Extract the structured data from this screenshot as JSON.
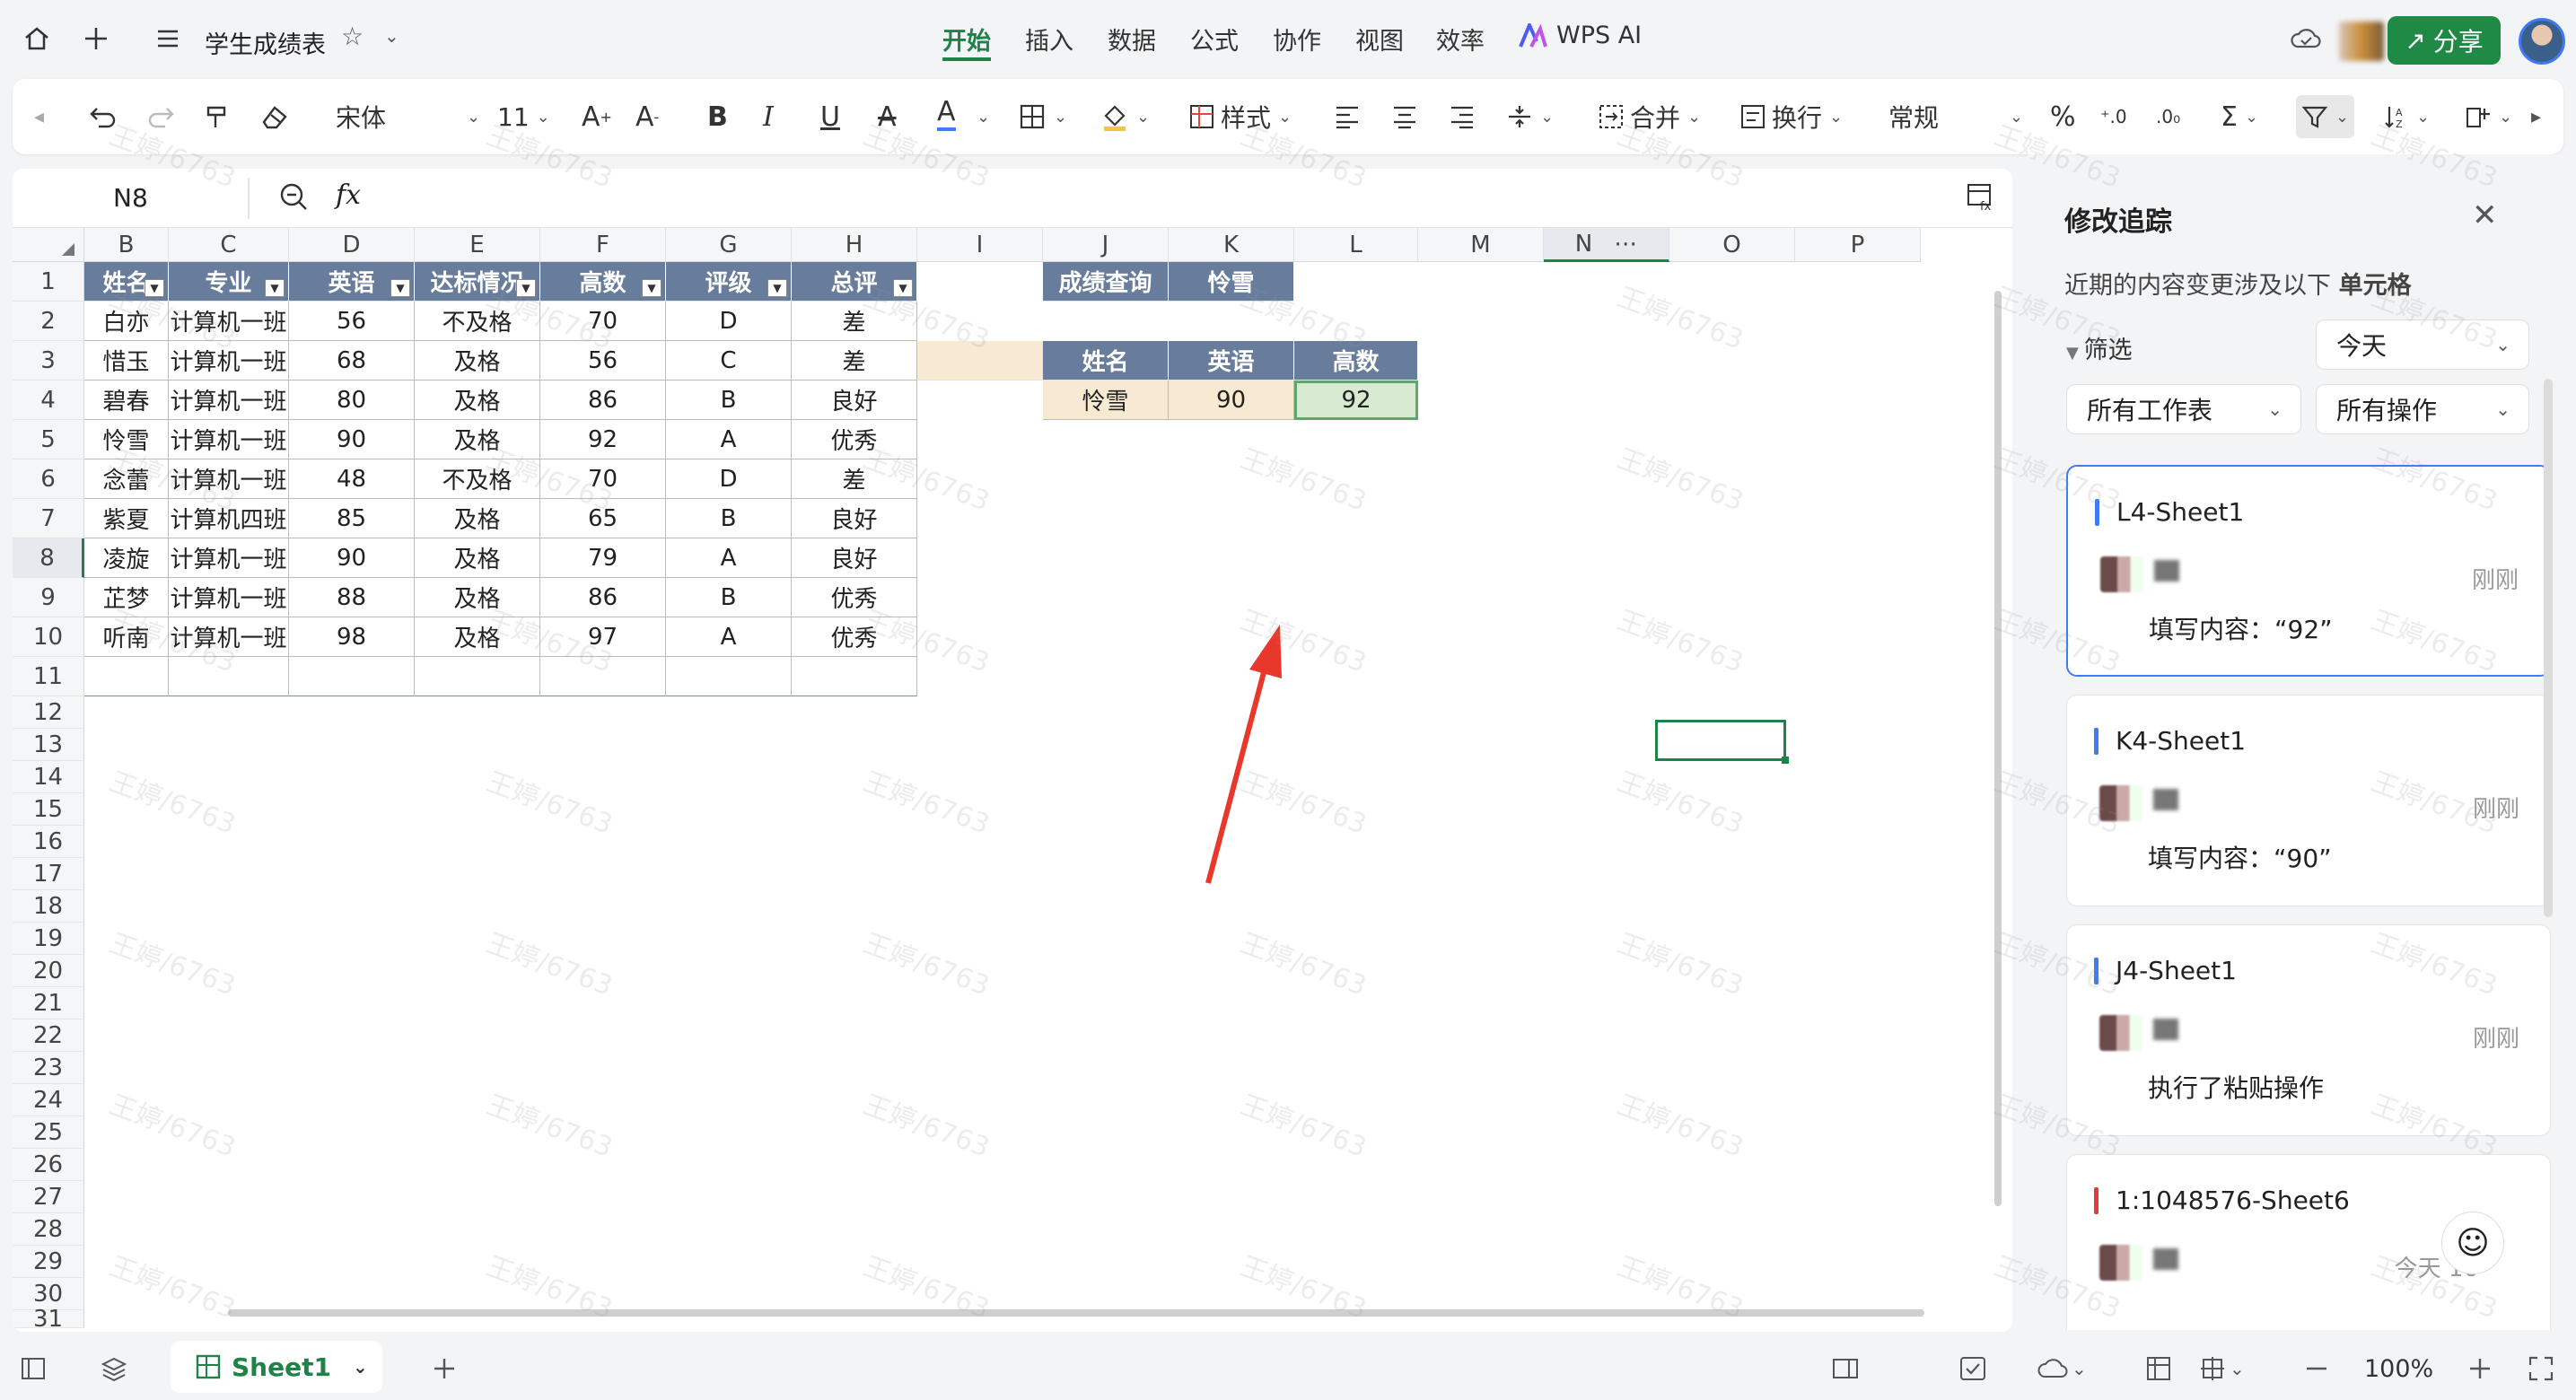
{
  "app": {
    "title": "学生成绩表",
    "menu": [
      "开始",
      "插入",
      "数据",
      "公式",
      "协作",
      "视图",
      "效率",
      "WPS AI"
    ],
    "active_menu": "开始",
    "share_label": "分享"
  },
  "toolbar": {
    "font": "宋体",
    "font_size": "11",
    "style_label": "样式",
    "merge_label": "合并",
    "wrap_label": "换行",
    "number_format": "常规"
  },
  "formula_bar": {
    "cell_ref": "N8",
    "fx": "fx",
    "value": ""
  },
  "columns": [
    "B",
    "C",
    "D",
    "E",
    "F",
    "G",
    "H",
    "I",
    "J",
    "K",
    "L",
    "M",
    "N",
    "O",
    "P"
  ],
  "rows": [
    "1",
    "2",
    "3",
    "4",
    "5",
    "6",
    "7",
    "8",
    "9",
    "10",
    "11",
    "12",
    "13",
    "14",
    "15",
    "16",
    "17",
    "18",
    "19",
    "20",
    "21",
    "22",
    "23",
    "24",
    "25",
    "26",
    "27",
    "28",
    "29",
    "30",
    "31"
  ],
  "table": {
    "headers": [
      "姓名",
      "专业",
      "英语",
      "达标情况",
      "高数",
      "评级",
      "总评"
    ],
    "rows": [
      [
        "白亦",
        "计算机一班",
        "56",
        "不及格",
        "70",
        "D",
        "差"
      ],
      [
        "惜玉",
        "计算机一班",
        "68",
        "及格",
        "56",
        "C",
        "差"
      ],
      [
        "碧春",
        "计算机一班",
        "80",
        "及格",
        "86",
        "B",
        "良好"
      ],
      [
        "怜雪",
        "计算机一班",
        "90",
        "及格",
        "92",
        "A",
        "优秀"
      ],
      [
        "念蕾",
        "计算机一班",
        "48",
        "不及格",
        "70",
        "D",
        "差"
      ],
      [
        "紫夏",
        "计算机四班",
        "85",
        "及格",
        "65",
        "B",
        "良好"
      ],
      [
        "凌旋",
        "计算机一班",
        "90",
        "及格",
        "79",
        "A",
        "良好"
      ],
      [
        "芷梦",
        "计算机一班",
        "88",
        "及格",
        "86",
        "B",
        "优秀"
      ],
      [
        "听南",
        "计算机一班",
        "98",
        "及格",
        "97",
        "A",
        "优秀"
      ]
    ]
  },
  "query": {
    "label": "成绩查询",
    "name_value": "怜雪",
    "headers": [
      "姓名",
      "英语",
      "高数"
    ],
    "result": [
      "怜雪",
      "90",
      "92"
    ]
  },
  "panel": {
    "title": "修改追踪",
    "subtitle_prefix": "近期的内容变更涉及以下",
    "subtitle_bold": "单元格",
    "filter_label": "筛选",
    "date_filter": "今天",
    "sheet_filter": "所有工作表",
    "op_filter": "所有操作",
    "cards": [
      {
        "ref": "L4-Sheet1",
        "time": "刚刚",
        "action": "填写内容：“92”",
        "color": "#3e7bf5"
      },
      {
        "ref": "K4-Sheet1",
        "time": "刚刚",
        "action": "填写内容：“90”",
        "color": "#3e7bf5"
      },
      {
        "ref": "J4-Sheet1",
        "time": "刚刚",
        "action": "执行了粘贴操作",
        "color": "#3e7bf5"
      },
      {
        "ref": "1:1048576-Sheet6",
        "time": "今天 16",
        "action": "",
        "color": "#e03c3c"
      }
    ]
  },
  "status": {
    "sheet_tab": "Sheet1",
    "zoom": "100%"
  },
  "watermark": "王婷/6763"
}
